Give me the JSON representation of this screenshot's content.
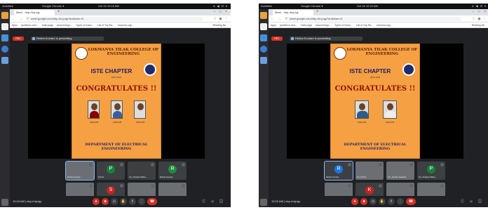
{
  "colors": {
    "meet_bg": "#202124",
    "poster": "#f5a043",
    "end_call": "#d93025",
    "rec": "#d93025"
  },
  "shots": [
    {
      "topbar": {
        "activities": "Activities",
        "app": "Google Chrome ▾",
        "clock": "Oct 24 10:15 AM",
        "sys": "A ◀ ⏻ ▾"
      },
      "tab_title": "Meet - nbp-rhuj-iqy",
      "url": "meet.google.com/nbp-rhuj-iqy?authuser=0",
      "bookmarks": [
        "Apps",
        "questions and...",
        "India page",
        "www.energo...",
        "Types of Indus...",
        "List of Top Ra...",
        "www.iea.org/..."
      ],
      "reading_list": "Reading list",
      "rec_label": "REC",
      "presenting": "Rekha Kumare is presenting",
      "poster": {
        "college": "LOKMANYA TILAK COLLEGE OF ENGINEERING",
        "chapter": "ISTE CHAPTER",
        "year": "2021-2022",
        "congrats": "CONGRATULATES !!",
        "dept": "DEPARTMENT OF ELECTRICAL ENGINEERING",
        "winners": [
          "CGPA 9.85",
          "CGPA 9.85",
          "CGPA 9.83"
        ]
      },
      "tiles": [
        "Rekha Kumare",
        "Prachi",
        "SC_Suhasini Baha...",
        "Rekha Kumare",
        "SC_Shashank Ghodke",
        "SC_Swara Shetty",
        "SC_Aditi",
        "You"
      ],
      "time": "10:15 AM | nbp-rhuj-iqy"
    },
    {
      "topbar": {
        "activities": "Activities",
        "app": "Google Chrome ▾",
        "clock": "Oct 24 10:22 AM",
        "sys": "A ◀ ⏻ ▾"
      },
      "tab_title": "Meet - nbp-rhuj-iqy",
      "url": "meet.google.com/nbp-rhuj-iqy?authuser=0",
      "bookmarks": [
        "Apps",
        "questions and...",
        "India page",
        "www.energo...",
        "Types of Indus...",
        "List of Top Ra...",
        "www.iea.org/..."
      ],
      "reading_list": "Reading list",
      "rec_label": "REC",
      "presenting": "Rekha Kumare is presenting",
      "poster": {
        "college": "LOKMANYA TILAK COLLEGE OF ENGINEERING",
        "chapter": "ISTE CHAPTER",
        "year": "2021-2022",
        "congrats": "CONGRATULATES !!",
        "dept": "DEPARTMENT OF ELECTRICAL ENGINEERING",
        "winners": [
          "CGPA 9.56",
          "CGPA 9.56"
        ]
      },
      "tiles": [
        "Rekha Kumare",
        "SC_Prachi",
        "SC_Janhavi Gadekar",
        "SC_Suhasini Baha...",
        "SC_Shashank Ghodk...",
        "SC_Aditi",
        "SC_Aditi",
        "You"
      ],
      "time": "10:22 AM | nbp-rhuj-iqy"
    }
  ]
}
